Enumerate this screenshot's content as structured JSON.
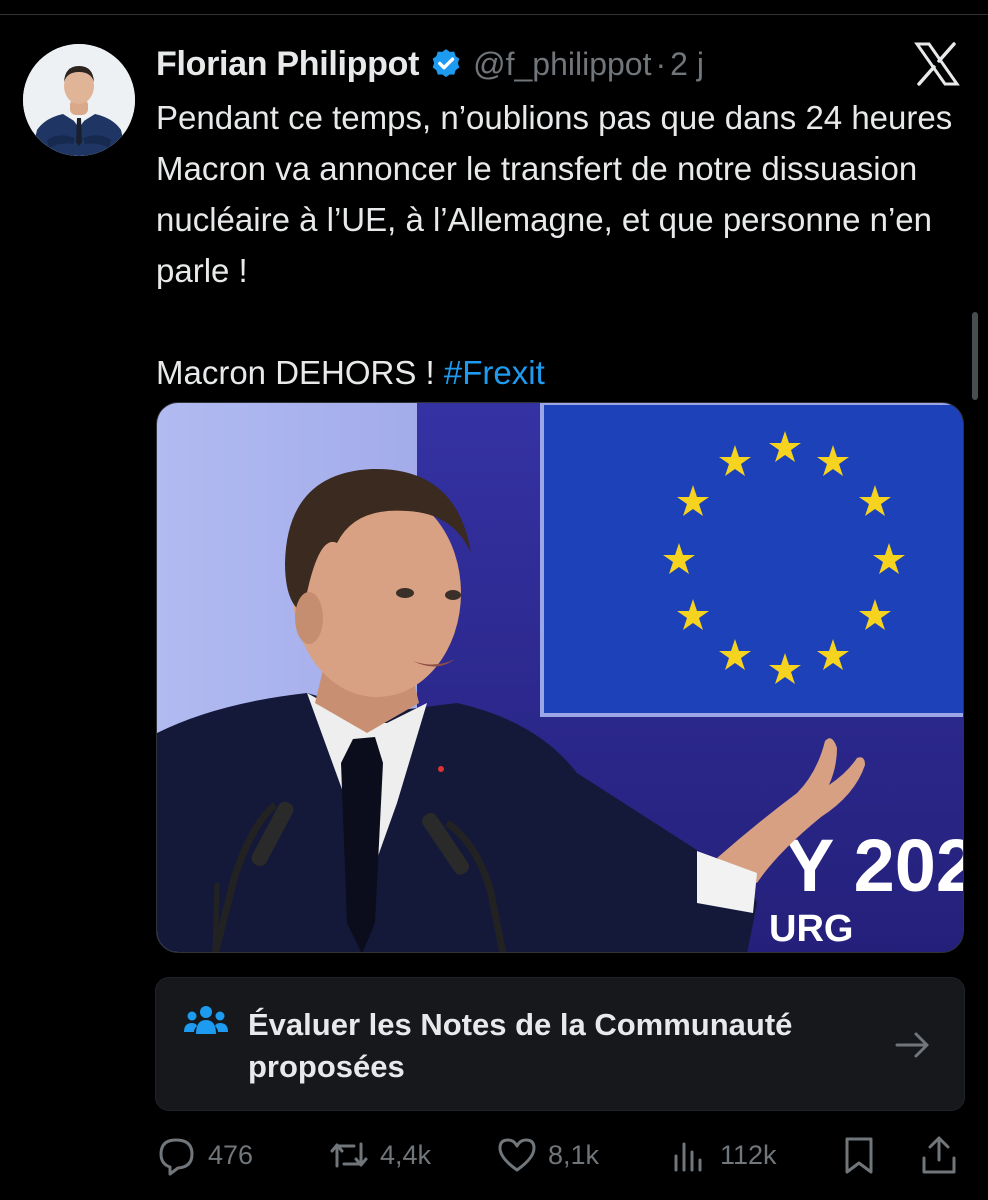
{
  "author": {
    "display_name": "Florian Philippot",
    "handle": "@f_philippot",
    "age": "2 j",
    "separator": "·"
  },
  "tweet": {
    "paragraph1": "Pendant ce temps, n’oublions pas que dans 24 heures Macron va annoncer le transfert de notre dissuasion nucléaire à l’UE, à l’Allemagne, et que personne n’en parle !",
    "paragraph2_text": "Macron DEHORS ! ",
    "hashtag": "#Frexit"
  },
  "media": {
    "banner_text": "Y 202",
    "banner_sub": "URG"
  },
  "community_notes": {
    "label": "Évaluer les Notes de la Communauté proposées"
  },
  "actions": {
    "replies": "476",
    "reposts": "4,4k",
    "likes": "8,1k",
    "views": "112k"
  },
  "icons": {
    "verified": "verified-badge-icon",
    "x_logo": "x-logo-icon",
    "notes": "people-icon",
    "arrow": "arrow-right-icon",
    "reply": "reply-icon",
    "repost": "repost-icon",
    "like": "heart-icon",
    "views": "views-icon",
    "bookmark": "bookmark-icon",
    "share": "share-icon"
  },
  "colors": {
    "background": "#000000",
    "text": "#e7e9ea",
    "muted": "#71767b",
    "accent": "#1d9bf0",
    "card": "#16181c"
  }
}
